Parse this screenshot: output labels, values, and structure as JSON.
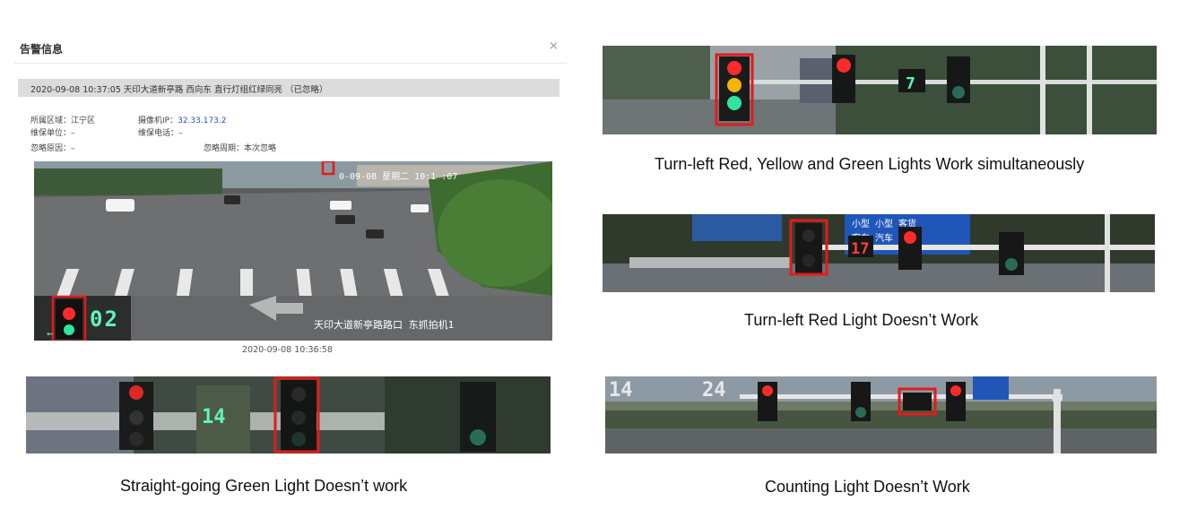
{
  "alert_dialog": {
    "title": "告警信息",
    "close_glyph": "×",
    "header": "2020-09-08 10:37:05  天印大道新亭路  西向东  直行灯组红绿同亮  （已忽略）",
    "fields": {
      "area_label": "所属区域：",
      "area_value": "江宁区",
      "camera_ip_label": "摄像机IP：",
      "camera_ip_value": "32.33.173.2",
      "maint_unit_label": "维保单位：",
      "maint_unit_value": "–",
      "maint_phone_label": "维保电话：",
      "maint_phone_value": "–",
      "ignore_reason_label": "忽略原因：",
      "ignore_reason_value": "–",
      "ignore_period_label": "忽略周期：",
      "ignore_period_value": "本次忽略"
    },
    "scene": {
      "overlay_timestamp": "0-09-08  星期二  10:1 :07",
      "countdown": "02",
      "location_overlay": "天印大道新亭路路口  东抓拍机1"
    },
    "image_caption": "2020-09-08 10:36:58"
  },
  "examples": {
    "straight_green": {
      "caption": "Straight-going Green Light Doesn’t work",
      "countdown": "14"
    },
    "turn_left_ryg": {
      "caption": "Turn-left Red, Yellow and Green Lights Work simultaneously"
    },
    "turn_left_red": {
      "caption": "Turn-left Red Light Doesn’t Work",
      "sign_line1": "小型 小型 客货",
      "sign_line2": "客车 汽车 车辆",
      "countdown": "17"
    },
    "counting_light": {
      "caption": "Counting Light Doesn’t Work",
      "countdown_left": "14",
      "countdown_right": "24"
    }
  },
  "colors": {
    "highlight_box": "#e31b1b",
    "red_light": "#ff2a2a",
    "yellow_light": "#f4b400",
    "green_light": "#2ee6a0",
    "countdown_digits": "#5df5b8"
  }
}
